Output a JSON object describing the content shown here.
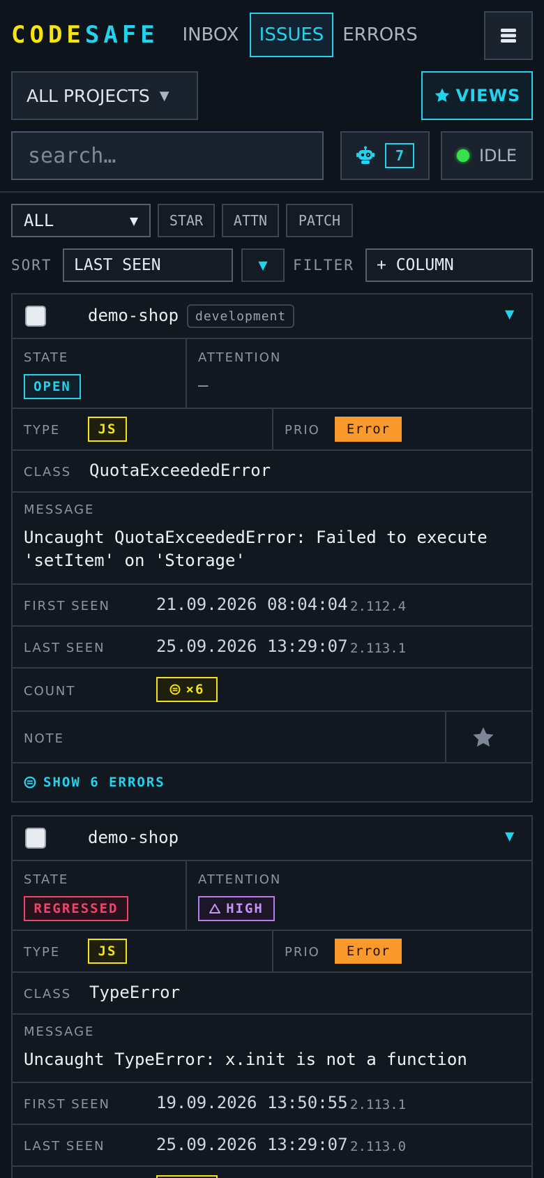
{
  "header": {
    "logo_part1": "CODE",
    "logo_part2": "SAFE",
    "nav": [
      {
        "label": "INBOX",
        "active": false
      },
      {
        "label": "ISSUES",
        "active": true
      },
      {
        "label": "ERRORS",
        "active": false
      }
    ]
  },
  "toolbar": {
    "project_select": "ALL PROJECTS",
    "views_label": "VIEWS",
    "search_placeholder": "search…",
    "bot_count": "7",
    "status_label": "IDLE"
  },
  "filters": {
    "scope_select": "ALL",
    "chips": [
      "STAR",
      "ATTN",
      "PATCH"
    ],
    "sort_label": "SORT",
    "sort_value": "LAST SEEN",
    "filter_label": "FILTER",
    "add_column": "+ COLUMN"
  },
  "labels": {
    "state": "STATE",
    "attention": "ATTENTION",
    "type": "TYPE",
    "prio": "PRIO",
    "class": "CLASS",
    "message": "MESSAGE",
    "first_seen": "FIRST SEEN",
    "last_seen": "LAST SEEN",
    "count": "COUNT",
    "note": "NOTE"
  },
  "issues": [
    {
      "project": "demo-shop",
      "environment": "development",
      "state": "OPEN",
      "attention": "—",
      "type": "JS",
      "prio": "Error",
      "class": "QuotaExceededError",
      "message": "Uncaught QuotaExceededError: Failed to execute 'setItem' on 'Storage'",
      "first_seen": "21.09.2026 08:04:04",
      "first_version": "2.112.4",
      "last_seen": "25.09.2026 13:29:07",
      "last_version": "2.113.1",
      "count": "×6",
      "show_errors": "SHOW 6 ERRORS"
    },
    {
      "project": "demo-shop",
      "state": "REGRESSED",
      "attention": "HIGH",
      "type": "JS",
      "prio": "Error",
      "class": "TypeError",
      "message": "Uncaught TypeError: x.init is not a function",
      "first_seen": "19.09.2026 13:50:55",
      "first_version": "2.113.1",
      "last_seen": "25.09.2026 13:29:07",
      "last_version": "2.113.0"
    }
  ],
  "colors": {
    "accent": "#22d3ee",
    "logo_yellow": "#f5e50b",
    "error_orange": "#fb9a2c",
    "regressed_red": "#f0436b",
    "high_purple": "#b57cf2",
    "status_green": "#37e24a"
  }
}
